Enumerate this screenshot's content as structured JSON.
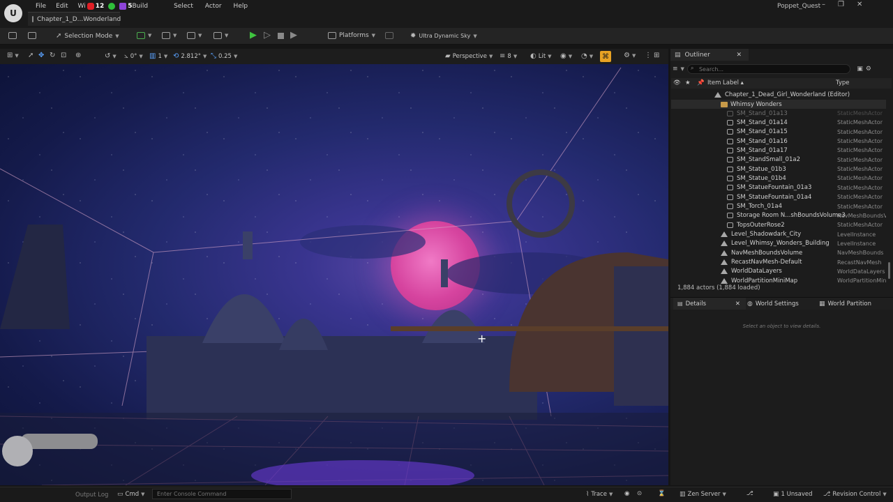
{
  "menu": [
    "File",
    "Edit",
    "Wi",
    "",
    "Build",
    "Select",
    "Actor",
    "Help"
  ],
  "overlay_badges": [
    {
      "count": "12",
      "color": "#e01f26",
      "icon": "youtube-icon"
    },
    {
      "count": "",
      "color": "#2fbf3a",
      "icon": "kick-icon"
    },
    {
      "count": "5",
      "color": "#8d44d8",
      "icon": "twitch-icon"
    }
  ],
  "level_tab": "Chapter_1_D...Wonderland",
  "project_name": "Poppet_Quest",
  "toolbar": {
    "selection_mode": "Selection Mode",
    "platforms": "Platforms",
    "sky": "Ultra Dynamic Sky"
  },
  "viewport_toolbar": {
    "rotation_snap": "0°",
    "grid_snap": "1",
    "scale_value": "2.812°",
    "snap_scale": "0.25",
    "view_mode": "Perspective",
    "camera_speed": "8",
    "lit": "Lit"
  },
  "outliner": {
    "title": "Outliner",
    "search_placeholder": "Search...",
    "col_label": "Item Label ▴",
    "col_type": "Type",
    "root": "Chapter_1_Dead_Girl_Wonderland (Editor)",
    "folder": "Whimsy Wonders",
    "items": [
      {
        "label": "SM_Stand_01a13",
        "type": "StaticMeshActor",
        "kind": "mesh"
      },
      {
        "label": "SM_Stand_01a14",
        "type": "StaticMeshActor",
        "kind": "mesh"
      },
      {
        "label": "SM_Stand_01a15",
        "type": "StaticMeshActor",
        "kind": "mesh"
      },
      {
        "label": "SM_Stand_01a16",
        "type": "StaticMeshActor",
        "kind": "mesh"
      },
      {
        "label": "SM_Stand_01a17",
        "type": "StaticMeshActor",
        "kind": "mesh"
      },
      {
        "label": "SM_StandSmall_01a2",
        "type": "StaticMeshActor",
        "kind": "mesh"
      },
      {
        "label": "SM_Statue_01b3",
        "type": "StaticMeshActor",
        "kind": "mesh"
      },
      {
        "label": "SM_Statue_01b4",
        "type": "StaticMeshActor",
        "kind": "mesh"
      },
      {
        "label": "SM_StatueFountain_01a3",
        "type": "StaticMeshActor",
        "kind": "mesh"
      },
      {
        "label": "SM_StatueFountain_01a4",
        "type": "StaticMeshActor",
        "kind": "mesh"
      },
      {
        "label": "SM_Torch_01a4",
        "type": "StaticMeshActor",
        "kind": "mesh"
      },
      {
        "label": "Storage Room N...shBoundsVolume3",
        "type": "NavMeshBoundsV",
        "kind": "mesh"
      },
      {
        "label": "TopsOuterRose2",
        "type": "StaticMeshActor",
        "kind": "mesh"
      },
      {
        "label": "Level_Shadowdark_City",
        "type": "LevelInstance",
        "kind": "level"
      },
      {
        "label": "Level_Whimsy_Wonders_Building",
        "type": "LevelInstance",
        "kind": "level"
      },
      {
        "label": "NavMeshBoundsVolume",
        "type": "NavMeshBounds",
        "kind": "level"
      },
      {
        "label": "RecastNavMesh-Default",
        "type": "RecastNavMesh",
        "kind": "level"
      },
      {
        "label": "WorldDataLayers",
        "type": "WorldDataLayers",
        "kind": "level"
      },
      {
        "label": "WorldPartitionMiniMap",
        "type": "WorldPartitionMin",
        "kind": "level"
      }
    ],
    "actor_count": "1,884 actors (1,884 loaded)"
  },
  "details": {
    "tab_details": "Details",
    "tab_world_settings": "World Settings",
    "tab_world_partition": "World Partition",
    "empty_hint": "Select an object to view details."
  },
  "statusbar": {
    "output_log": "Output Log",
    "cmd": "Cmd",
    "console_placeholder": "Enter Console Command",
    "trace": "Trace",
    "zen_server": "Zen Server",
    "unsaved": "1 Unsaved",
    "revision_control": "Revision Control"
  }
}
